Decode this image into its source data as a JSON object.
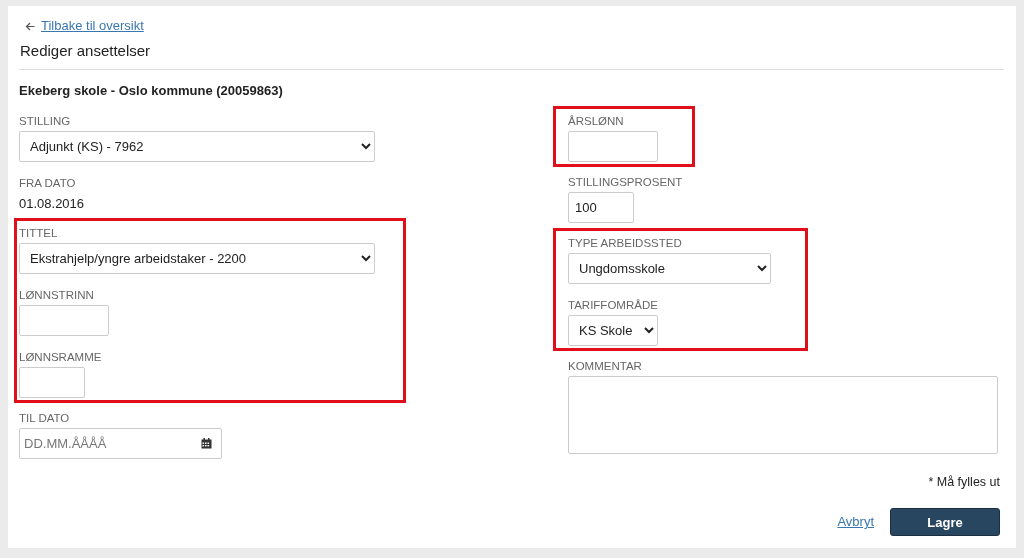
{
  "back_link": {
    "label": "Tilbake til oversikt"
  },
  "title": "Rediger ansettelser",
  "organization": "Ekeberg skole - Oslo kommune (20059863)",
  "columns": [
    [
      {
        "highlighted": false,
        "fields": [
          {
            "kind": "select",
            "label": "STILLING",
            "value": "Adjunkt (KS) - 7962"
          },
          {
            "kind": "static",
            "label": "FRA DATO",
            "value": "01.08.2016"
          }
        ]
      },
      {
        "highlighted": true,
        "fields": [
          {
            "kind": "select",
            "label": "TITTEL",
            "value": "Ekstrahjelp/yngre arbeidstaker - 2200"
          },
          {
            "kind": "text",
            "label": "LØNNSTRINN"
          },
          {
            "kind": "text",
            "label": "LØNNSRAMME"
          }
        ]
      },
      {
        "highlighted": false,
        "fields": [
          {
            "kind": "date",
            "label": "TIL DATO",
            "placeholder": "DD.MM.ÅÅÅÅ"
          }
        ]
      }
    ],
    [
      {
        "highlighted": true,
        "fields": [
          {
            "kind": "text",
            "label": "ÅRSLØNN"
          }
        ]
      },
      {
        "highlighted": false,
        "fields": [
          {
            "kind": "text",
            "label": "STILLINGSPROSENT",
            "value": "100"
          }
        ]
      },
      {
        "highlighted": true,
        "fields": [
          {
            "kind": "select",
            "label": "TYPE ARBEIDSSTED",
            "value": "Ungdomsskole"
          },
          {
            "kind": "select",
            "label": "TARIFFOMRÅDE",
            "value": "KS Skole"
          }
        ]
      },
      {
        "highlighted": false,
        "fields": [
          {
            "kind": "textarea",
            "label": "KOMMENTAR"
          }
        ]
      }
    ]
  ],
  "required_note": "* Må fylles ut",
  "actions": {
    "cancel": "Avbryt",
    "save": "Lagre"
  }
}
